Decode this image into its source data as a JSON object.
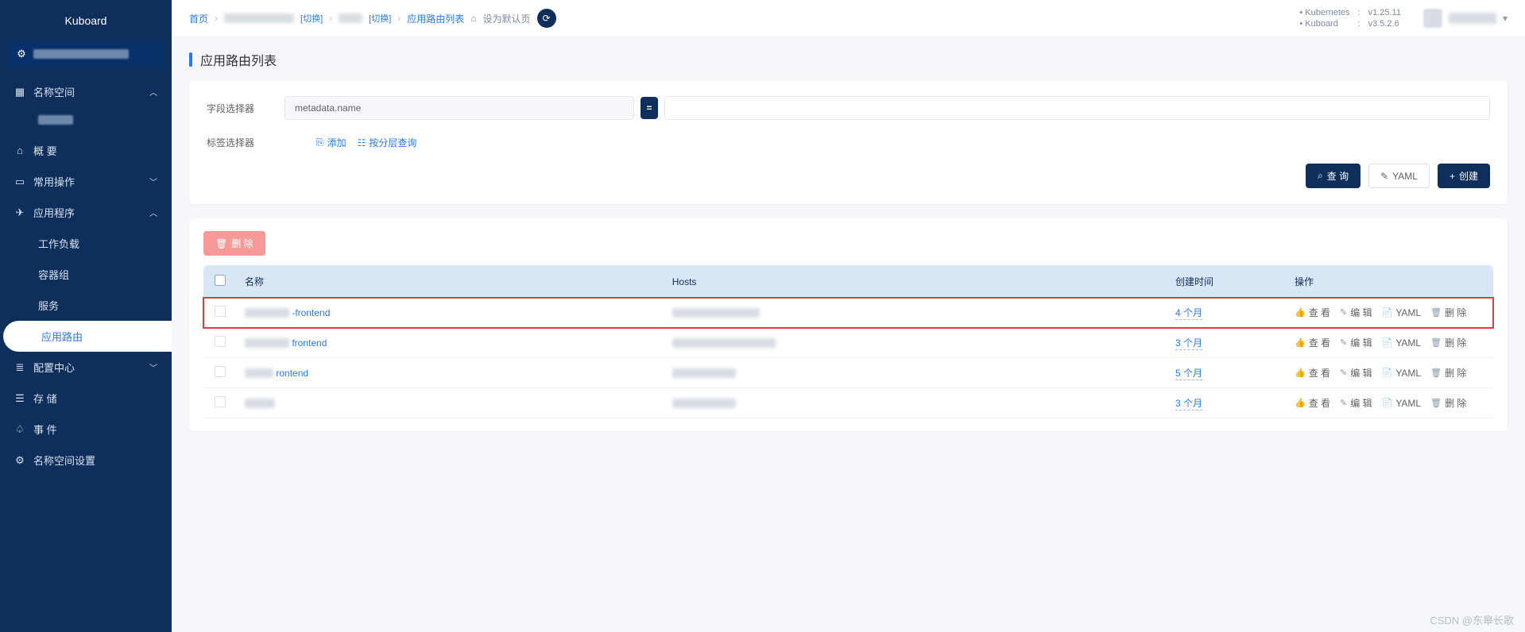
{
  "brand": "Kuboard",
  "sidebar": {
    "namespace_label": "名称空间",
    "overview": "概 要",
    "common_ops": "常用操作",
    "apps": "应用程序",
    "workloads": "工作负载",
    "pods": "容器组",
    "services": "服务",
    "ingress": "应用路由",
    "config_center": "配置中心",
    "storage": "存 储",
    "events": "事 件",
    "ns_settings": "名称空间设置"
  },
  "breadcrumb": {
    "home": "首页",
    "switch": "[切换]",
    "list": "应用路由列表",
    "set_default": "设为默认页"
  },
  "versions": {
    "k8s_label": "Kubernetes",
    "k8s_value": "v1.25.11",
    "kb_label": "Kuboard",
    "kb_value": "v3.5.2.6"
  },
  "page_title": "应用路由列表",
  "filters": {
    "field_selector_label": "字段选择器",
    "field_key": "metadata.name",
    "operator": "=",
    "label_selector_label": "标签选择器",
    "add_btn": "添加",
    "hier_btn": "按分层查询"
  },
  "buttons": {
    "query": "查 询",
    "yaml": "YAML",
    "create": "创建",
    "delete": "删 除"
  },
  "table": {
    "headers": {
      "name": "名称",
      "hosts": "Hosts",
      "created": "创建时间",
      "ops": "操作"
    },
    "row_actions": {
      "view": "查 看",
      "edit": "编 辑",
      "yaml": "YAML",
      "delete": "删 除"
    },
    "rows": [
      {
        "name_suffix": "-frontend",
        "created": "4 个月"
      },
      {
        "name_suffix": "frontend",
        "created": "3 个月"
      },
      {
        "name_suffix": "rontend",
        "created": "5 个月"
      },
      {
        "name_suffix": "",
        "created": "3 个月"
      }
    ]
  },
  "watermark": "CSDN @东皋长歌"
}
